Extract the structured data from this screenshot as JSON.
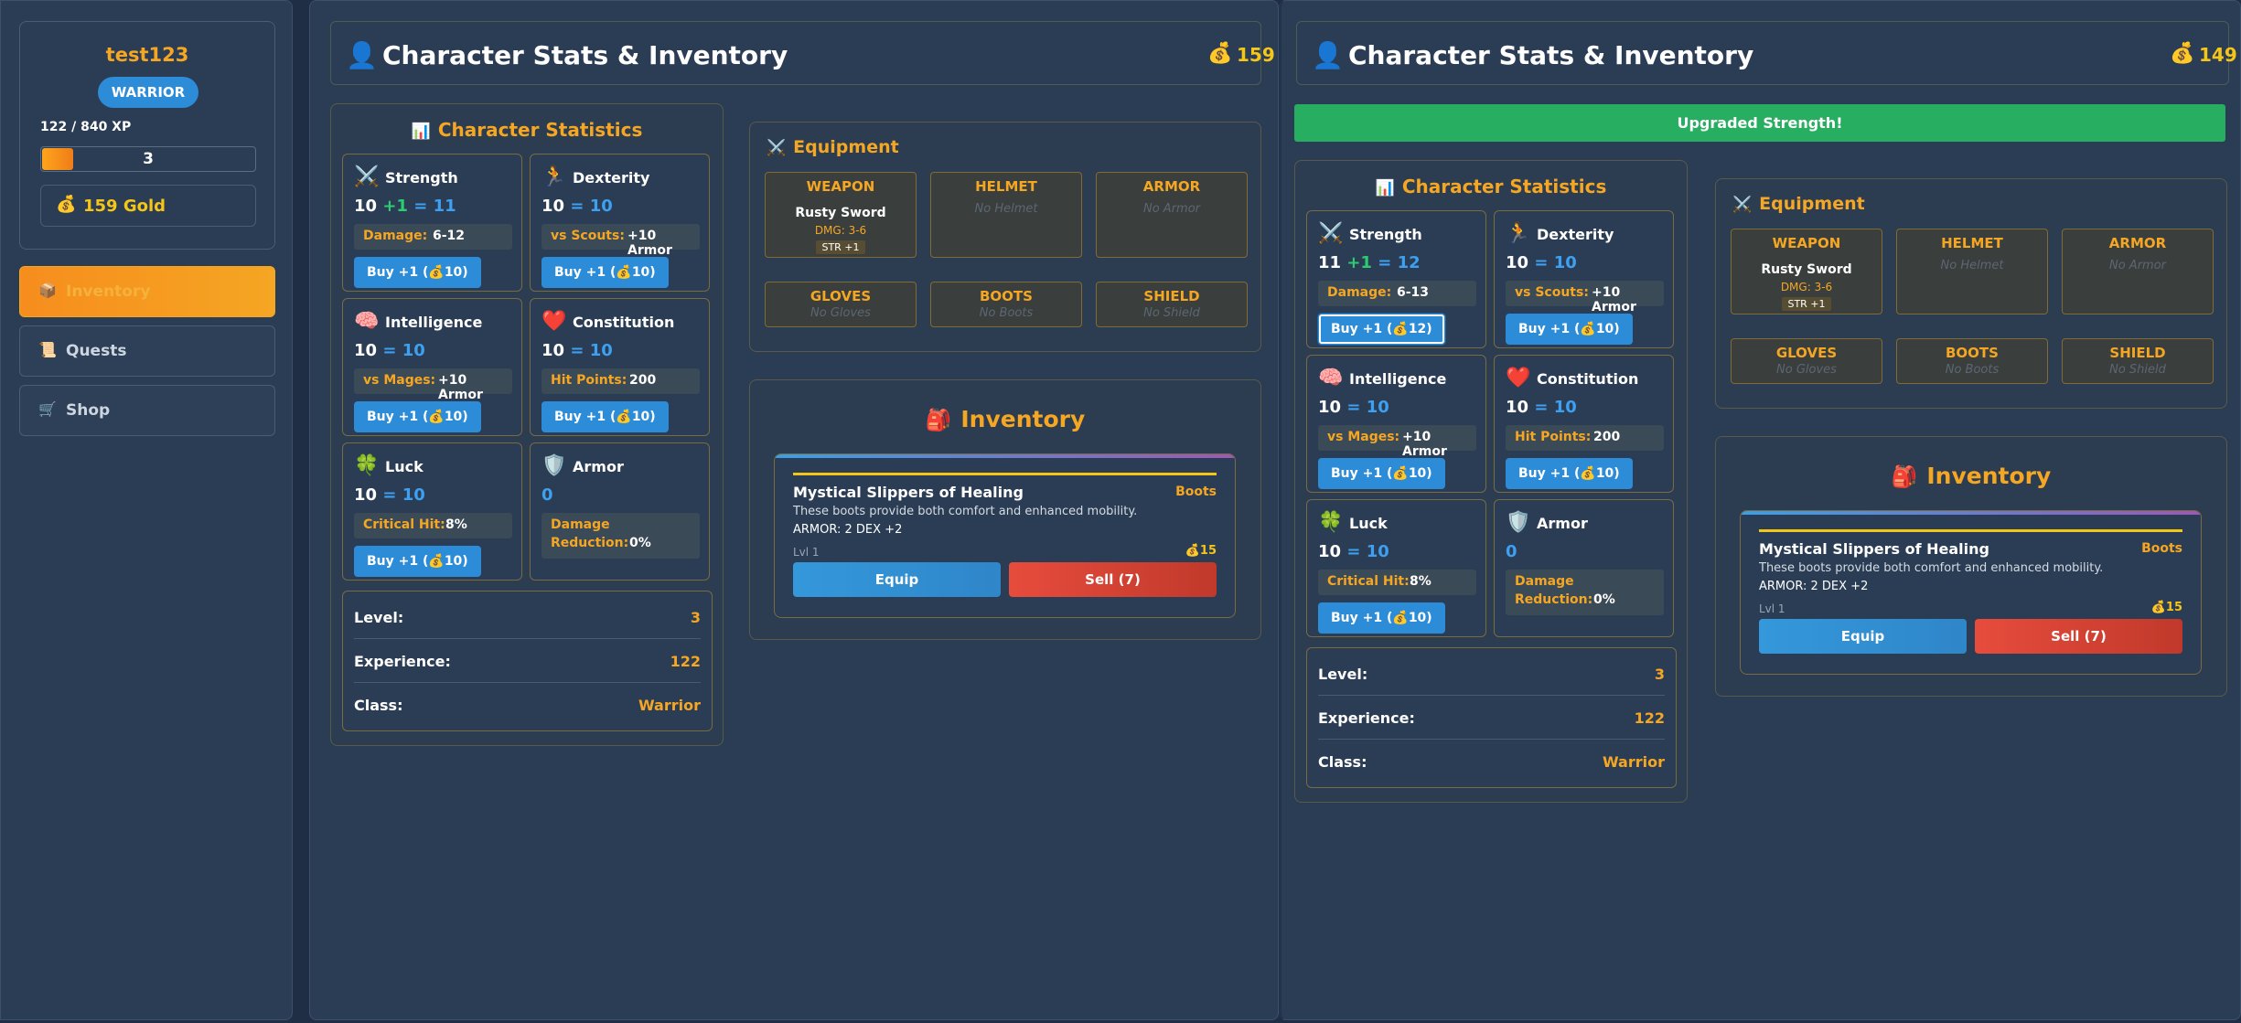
{
  "sidebar": {
    "username": "test123",
    "class_badge": "WARRIOR",
    "xp_text": "122 / 840 XP",
    "level": "3",
    "xp_progress": 0.145,
    "gold_icon": "💰",
    "gold_text": "159 Gold",
    "nav": [
      {
        "icon": "📦",
        "label": "Inventory"
      },
      {
        "icon": "📜",
        "label": "Quests"
      },
      {
        "icon": "🛒",
        "label": "Shop"
      }
    ]
  },
  "left": {
    "header": {
      "icon": "👤",
      "title": "Character Stats & Inventory",
      "gold_icon": "💰",
      "gold": "159"
    },
    "stats": {
      "title_icon": "📊",
      "title": "Character Statistics",
      "strength": {
        "icon": "⚔️",
        "name": "Strength",
        "base": "10",
        "plus": "+1",
        "total": "= 11",
        "box_key": "Damage:",
        "box_val": "6-12",
        "button": "Buy +1 (💰10)"
      },
      "dexterity": {
        "icon": "🏃",
        "name": "Dexterity",
        "base": "10",
        "total": "= 10",
        "box_key": "vs Scouts:",
        "box_val": "+10 Armor",
        "button": "Buy +1 (💰10)"
      },
      "intelligence": {
        "icon": "🧠",
        "name": "Intelligence",
        "base": "10",
        "total": "= 10",
        "box_key": "vs Mages:",
        "box_val": "+10 Armor",
        "button": "Buy +1 (💰10)"
      },
      "constitution": {
        "icon": "❤️",
        "name": "Constitution",
        "base": "10",
        "total": "= 10",
        "box_key": "Hit Points:",
        "box_val": "200",
        "button": "Buy +1 (💰10)"
      },
      "luck": {
        "icon": "🍀",
        "name": "Luck",
        "base": "10",
        "total": "= 10",
        "box_key": "Critical Hit:",
        "box_val": "8%",
        "button": "Buy +1 (💰10)"
      },
      "armor": {
        "icon": "🛡️",
        "name": "Armor",
        "value": "0",
        "box_key1": "Damage",
        "box_key2": "Reduction:",
        "box_val": "0%"
      },
      "summary": {
        "level_label": "Level:",
        "level": "3",
        "exp_label": "Experience:",
        "exp": "122",
        "class_label": "Class:",
        "class": "Warrior"
      }
    },
    "equipment": {
      "title_icon": "⚔️",
      "title": "Equipment",
      "slots": [
        {
          "label": "WEAPON",
          "name": "Rusty Sword",
          "dmg": "DMG: 3-6",
          "bonus": "STR +1"
        },
        {
          "label": "HELMET",
          "empty": "No Helmet"
        },
        {
          "label": "ARMOR",
          "empty": "No Armor"
        },
        {
          "label": "GLOVES",
          "empty": "No Gloves"
        },
        {
          "label": "BOOTS",
          "empty": "No Boots"
        },
        {
          "label": "SHIELD",
          "empty": "No Shield"
        }
      ]
    },
    "inventory": {
      "title_icon": "🎒",
      "title": "Inventory",
      "item": {
        "name": "Mystical Slippers of Healing",
        "type": "Boots",
        "desc": "These boots provide both comfort and enhanced mobility.",
        "stats": "ARMOR: 2  DEX +2",
        "level": "Lvl 1",
        "price": "💰15",
        "equip": "Equip",
        "sell": "Sell (7)"
      }
    }
  },
  "right": {
    "header": {
      "icon": "👤",
      "title": "Character Stats & Inventory",
      "gold_icon": "💰",
      "gold": "149"
    },
    "notice": "Upgraded Strength!",
    "stats": {
      "title_icon": "📊",
      "title": "Character Statistics",
      "strength": {
        "icon": "⚔️",
        "name": "Strength",
        "base": "11",
        "plus": "+1",
        "total": "= 12",
        "box_key": "Damage:",
        "box_val": "6-13",
        "button": "Buy +1 (💰12)"
      },
      "dexterity": {
        "icon": "🏃",
        "name": "Dexterity",
        "base": "10",
        "total": "= 10",
        "box_key": "vs Scouts:",
        "box_val": "+10 Armor",
        "button": "Buy +1 (💰10)"
      },
      "intelligence": {
        "icon": "🧠",
        "name": "Intelligence",
        "base": "10",
        "total": "= 10",
        "box_key": "vs Mages:",
        "box_val": "+10 Armor",
        "button": "Buy +1 (💰10)"
      },
      "constitution": {
        "icon": "❤️",
        "name": "Constitution",
        "base": "10",
        "total": "= 10",
        "box_key": "Hit Points:",
        "box_val": "200",
        "button": "Buy +1 (💰10)"
      },
      "luck": {
        "icon": "🍀",
        "name": "Luck",
        "base": "10",
        "total": "= 10",
        "box_key": "Critical Hit:",
        "box_val": "8%",
        "button": "Buy +1 (💰10)"
      },
      "armor": {
        "icon": "🛡️",
        "name": "Armor",
        "value": "0",
        "box_key1": "Damage",
        "box_key2": "Reduction:",
        "box_val": "0%"
      },
      "summary": {
        "level_label": "Level:",
        "level": "3",
        "exp_label": "Experience:",
        "exp": "122",
        "class_label": "Class:",
        "class": "Warrior"
      }
    },
    "equipment": {
      "title_icon": "⚔️",
      "title": "Equipment",
      "slots": [
        {
          "label": "WEAPON",
          "name": "Rusty Sword",
          "dmg": "DMG: 3-6",
          "bonus": "STR +1"
        },
        {
          "label": "HELMET",
          "empty": "No Helmet"
        },
        {
          "label": "ARMOR",
          "empty": "No Armor"
        },
        {
          "label": "GLOVES",
          "empty": "No Gloves"
        },
        {
          "label": "BOOTS",
          "empty": "No Boots"
        },
        {
          "label": "SHIELD",
          "empty": "No Shield"
        }
      ]
    },
    "inventory": {
      "title_icon": "🎒",
      "title": "Inventory",
      "item": {
        "name": "Mystical Slippers of Healing",
        "type": "Boots",
        "desc": "These boots provide both comfort and enhanced mobility.",
        "stats": "ARMOR: 2  DEX +2",
        "level": "Lvl 1",
        "price": "💰15",
        "equip": "Equip",
        "sell": "Sell (7)"
      }
    }
  },
  "colors": {
    "accent": "#f5a623",
    "primary": "#2d8cd8",
    "success": "#27ae60",
    "danger": "#e74c3c",
    "background": "#1f2e44",
    "panel": "#2b3d55"
  }
}
